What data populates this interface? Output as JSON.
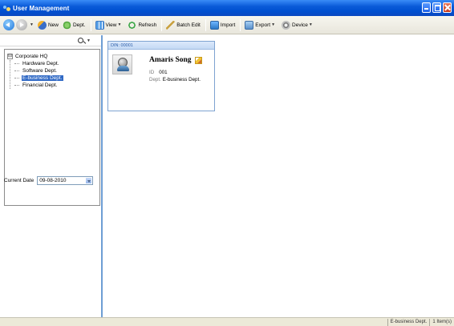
{
  "window": {
    "title": "User Management"
  },
  "toolbar": {
    "new_label": "New",
    "dept_label": "Dept.",
    "view_label": "View",
    "refresh_label": "Refresh",
    "batch_edit_label": "Batch Edit",
    "import_label": "Import",
    "export_label": "Export",
    "device_label": "Device"
  },
  "tree": {
    "root": "Corporate HQ",
    "root_expander": "⊟",
    "children": [
      {
        "label": "Hardware Dept."
      },
      {
        "label": "Software Dept."
      },
      {
        "label": "E-business Dept.",
        "selected": true
      },
      {
        "label": "Financial Dept."
      }
    ]
  },
  "filter": {
    "current_date_label": "Current Date",
    "current_date_value": "09-08-2010"
  },
  "card": {
    "din": "DIN: 00001",
    "name": "Amaris Song",
    "id_label": "ID",
    "id_value": "001",
    "dept_label": "Dept.",
    "dept_value": "E-business Dept."
  },
  "status": {
    "department": "E-business Dept.",
    "item_count": "1 Item(s)"
  }
}
